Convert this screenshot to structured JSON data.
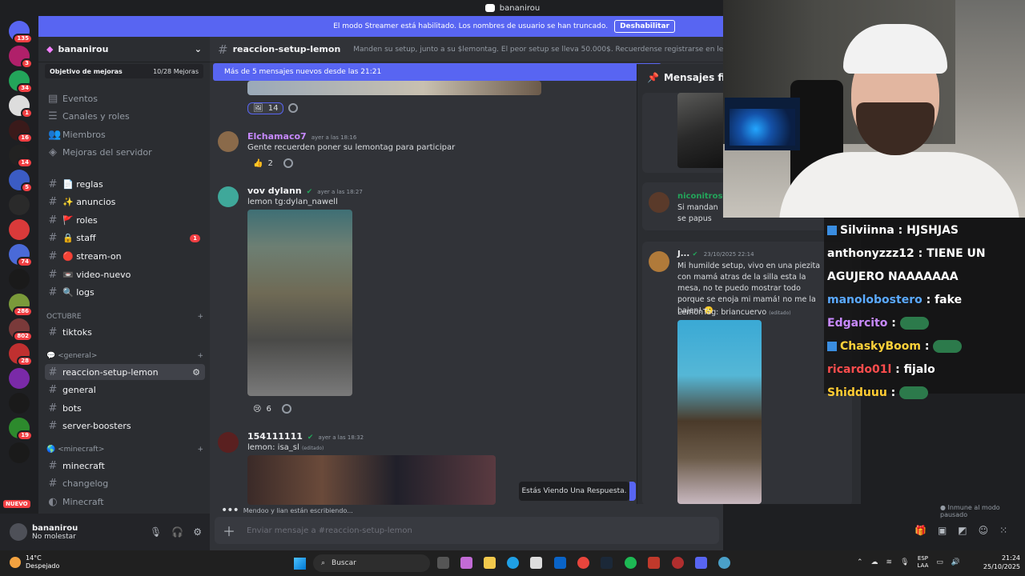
{
  "titlebar": {
    "title": "bananirou"
  },
  "banner": {
    "text": "El modo Streamer está habilitado. Los nombres de usuario se han truncado.",
    "button": "Deshabilitar"
  },
  "rail": {
    "badges": [
      "135",
      "3",
      "34",
      "1",
      "16",
      "14",
      "5",
      "",
      "",
      "74",
      "",
      "286",
      "802",
      "28",
      "",
      "",
      "19",
      ""
    ],
    "nuevo": "NUEVO"
  },
  "sidebar": {
    "server_name": "bananirou",
    "boost_goal": "Objetivo de mejoras",
    "boost_count": "10/28 Mejoras",
    "top_items": [
      "Eventos",
      "Canales y roles",
      "Miembros",
      "Mejoras del servidor"
    ],
    "channels": [
      {
        "label": "📄 reglas"
      },
      {
        "label": "✨ anuncios"
      },
      {
        "label": "🚩 roles"
      },
      {
        "label": "🔒 staff",
        "badge": "1"
      },
      {
        "label": "🔴 stream-on"
      },
      {
        "label": "📼 video-nuevo"
      },
      {
        "label": "🔍 logs"
      }
    ],
    "cat_octubre": "OCTUBRE",
    "ch_tiktoks": "tiktoks",
    "cat_general": "💬 <general>",
    "general_channels": [
      "reaccion-setup-lemon",
      "general",
      "bots",
      "server-boosters"
    ],
    "cat_minecraft": "🌎 <minecraft>",
    "minecraft_channels": [
      "minecraft",
      "changelog",
      "Minecraft"
    ]
  },
  "user": {
    "name": "bananirou",
    "status": "No molestar"
  },
  "channel": {
    "name": "reaccion-setup-lemon",
    "topic": "Manden su setup, junto a su $lemontag. El peor setup se lleva 50.000$. Recuerdense registrarse en lemon con codigo #bananirou"
  },
  "new_messages_bar": "Más de 5 mensajes nuevos desde las 21:21",
  "messages": [
    {
      "reaction_count": "14"
    },
    {
      "author": "Elchamaco7",
      "time": "ayer a las 18:16",
      "text": "Gente recuerden poner su lemontag para participar",
      "reaction_emoji": "👍",
      "reaction_count": "2"
    },
    {
      "author": "vov dylann",
      "time": "ayer a las 18:27",
      "text": "lemon tg:dylan_nawell",
      "reaction_emoji": "😢",
      "reaction_count": "6"
    },
    {
      "author": "154111111",
      "time": "ayer a las 18:32",
      "text": "lemon: isa_sl",
      "edited": "(editado)"
    }
  ],
  "typing": {
    "text": "Mendoo y lian están escribiendo..."
  },
  "toast": "Estás Viendo Una Respuesta.",
  "composer": {
    "placeholder": "Enviar mensaje a #reaccion-setup-lemon"
  },
  "pinned": {
    "title": "Mensajes fija",
    "items": [
      {
        "author": "niconitroso",
        "text": "Si mandan se papus"
      },
      {
        "author": "J...",
        "time": "23/10/2025 22:14",
        "text": "Mi humilde setup, vivo en una piezita con mamá atras de la silla esta la mesa, no te puedo mostrar todo porque se enoja mi mamá! no me la bajen! 🙁",
        "lemontag": "LemonTag: briancuervo",
        "edited": "(editado)"
      }
    ]
  },
  "immune": "Inmune al modo pausado",
  "stream_chat": [
    {
      "user": "Silviinna",
      "msg": "HJSHJAS",
      "color": "#ffffff"
    },
    {
      "user": "anthonyzzz12",
      "msg": "TIENE UN",
      "color": "#ffffff"
    },
    {
      "user": "",
      "msg": "AGUJERO NAAAAAAA",
      "color": "#ffffff"
    },
    {
      "user": "manolobostero",
      "msg": "fake",
      "color": "#5aa9ff"
    },
    {
      "user": "Edgarcito",
      "msg": "",
      "color": "#c889ff"
    },
    {
      "user": "ChaskyBoom",
      "msg": "",
      "color": "#ffd23a"
    },
    {
      "user": "ricardo01l",
      "msg": "fijalo",
      "color": "#ff4d4d"
    },
    {
      "user": "Shidduuu",
      "msg": "",
      "color": "#ffcc33"
    }
  ],
  "taskbar": {
    "temp": "14°C",
    "weather": "Despejado",
    "search": "Buscar",
    "lang1": "ESP",
    "lang2": "LAA",
    "time": "21:24",
    "date": "25/10/2025"
  },
  "colors": {
    "blurple": "#5865f2",
    "bg": "#313338",
    "sidebar": "#2b2d31",
    "red": "#f23f43",
    "green": "#23a55a"
  }
}
